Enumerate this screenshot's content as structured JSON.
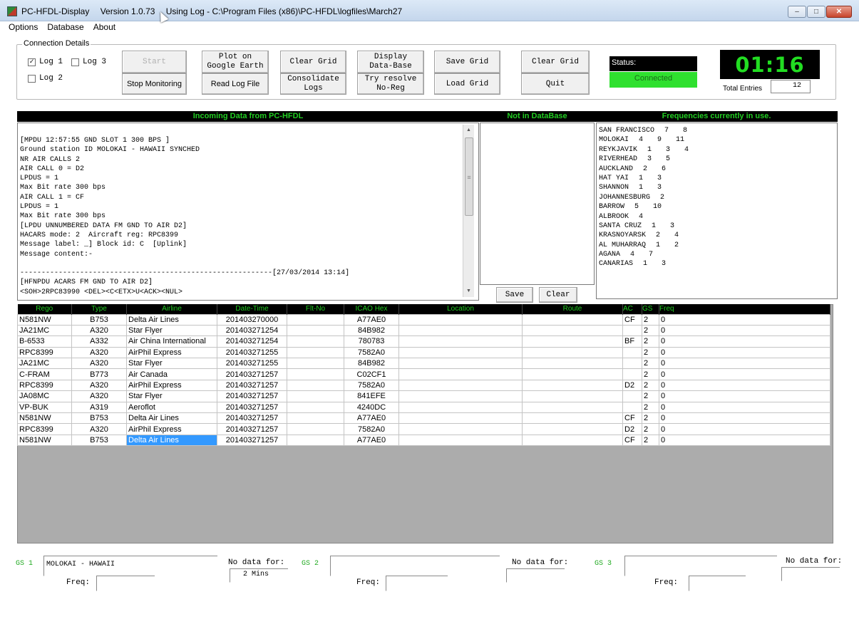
{
  "window": {
    "app_name": "PC-HFDL-Display",
    "version": "Version 1.0.73",
    "log_path": "Using Log - C:\\Program Files (x86)\\PC-HFDL\\logfiles\\March27"
  },
  "menu": [
    "Options",
    "Database",
    "About"
  ],
  "connection": {
    "legend": "Connection Details",
    "log1": "Log 1",
    "log2": "Log 2",
    "log3": "Log 3",
    "log1_checked": true,
    "buttons": {
      "start": "Start",
      "stop_monitoring": "Stop Monitoring",
      "plot_google_earth": "Plot on\nGoogle Earth",
      "read_log_file": "Read Log File",
      "clear_grid_1": "Clear Grid",
      "consolidate_logs": "Consolidate\nLogs",
      "display_database": "Display\nData-Base",
      "try_resolve": "Try resolve\nNo-Reg",
      "save_grid": "Save Grid",
      "load_grid": "Load Grid",
      "clear_grid_2": "Clear Grid",
      "quit": "Quit"
    },
    "status_label": "Status:",
    "status_value": "Connected",
    "clock": "01:16",
    "total_entries_label": "Total Entries",
    "total_entries": "12"
  },
  "panels": {
    "incoming_title": "Incoming Data from PC-HFDL",
    "not_in_db_title": "Not in DataBase",
    "freq_title": "Frequencies currently in use.",
    "incoming_text": "[MPDU 12:57:55 GND SLOT 1 300 BPS ]\nGround station ID MOLOKAI - HAWAII SYNCHED\nNR AIR CALLS 2\nAIR CALL 0 = D2\nLPDUS = 1\nMax Bit rate 300 bps\nAIR CALL 1 = CF\nLPDUS = 1\nMax Bit rate 300 bps\n[LPDU UNNUMBERED DATA FM GND TO AIR D2]\nHACARS mode: 2  Aircraft reg: RPC8399\nMessage label: _] Block id: C  [Uplink]\nMessage content:-\n\n-----------------------------------------------------------[27/03/2014 13:14]\n[HFNPDU ACARS FM GND TO AIR D2]\n<SOH>2RPC83990 <DEL><C<ETX>U<ACK><NUL>",
    "save": "Save",
    "clear": "Clear",
    "frequencies": [
      {
        "name": "SAN FRANCISCO",
        "f": [
          "7",
          "8",
          ""
        ]
      },
      {
        "name": "MOLOKAI",
        "f": [
          "4",
          "9",
          "11"
        ]
      },
      {
        "name": "REYKJAVIK",
        "f": [
          "1",
          "3",
          "4"
        ]
      },
      {
        "name": "RIVERHEAD",
        "f": [
          "3",
          "5",
          ""
        ]
      },
      {
        "name": "AUCKLAND",
        "f": [
          "2",
          "6",
          ""
        ]
      },
      {
        "name": "HAT YAI",
        "f": [
          "1",
          "3",
          ""
        ]
      },
      {
        "name": "SHANNON",
        "f": [
          "1",
          "3",
          ""
        ]
      },
      {
        "name": "JOHANNESBURG",
        "f": [
          "2",
          "",
          ""
        ]
      },
      {
        "name": "BARROW",
        "f": [
          "5",
          "10",
          ""
        ]
      },
      {
        "name": "ALBROOK",
        "f": [
          "4",
          "",
          ""
        ]
      },
      {
        "name": "SANTA CRUZ",
        "f": [
          "1",
          "3",
          ""
        ]
      },
      {
        "name": "KRASNOYARSK",
        "f": [
          "2",
          "4",
          ""
        ]
      },
      {
        "name": "AL MUHARRAQ",
        "f": [
          "1",
          "2",
          ""
        ]
      },
      {
        "name": "AGANA",
        "f": [
          "4",
          "7",
          ""
        ]
      },
      {
        "name": "CANARIAS",
        "f": [
          "1",
          "3",
          ""
        ]
      }
    ]
  },
  "grid": {
    "columns": [
      "Rego",
      "Type",
      "Airline",
      "Date-Time",
      "Flt-No",
      "ICAO Hex",
      "Location",
      "Route",
      "AC",
      "GS",
      "Freq"
    ],
    "rows": [
      [
        "N581NW",
        "B753",
        "Delta Air Lines",
        "201403270000",
        "",
        "A77AE0",
        "",
        "",
        "CF",
        "2",
        "0"
      ],
      [
        "JA21MC",
        "A320",
        "Star Flyer",
        "201403271254",
        "",
        "84B982",
        "",
        "",
        "",
        "2",
        "0"
      ],
      [
        "B-6533",
        "A332",
        "Air China International",
        "201403271254",
        "",
        "780783",
        "",
        "",
        "BF",
        "2",
        "0"
      ],
      [
        "RPC8399",
        "A320",
        "AirPhil Express",
        "201403271255",
        "",
        "7582A0",
        "",
        "",
        "",
        "2",
        "0"
      ],
      [
        "JA21MC",
        "A320",
        "Star Flyer",
        "201403271255",
        "",
        "84B982",
        "",
        "",
        "",
        "2",
        "0"
      ],
      [
        "C-FRAM",
        "B773",
        "Air Canada",
        "201403271257",
        "",
        "C02CF1",
        "",
        "",
        "",
        "2",
        "0"
      ],
      [
        "RPC8399",
        "A320",
        "AirPhil Express",
        "201403271257",
        "",
        "7582A0",
        "",
        "",
        "D2",
        "2",
        "0"
      ],
      [
        "JA08MC",
        "A320",
        "Star Flyer",
        "201403271257",
        "",
        "841EFE",
        "",
        "",
        "",
        "2",
        "0"
      ],
      [
        "VP-BUK",
        "A319",
        "Aeroflot",
        "201403271257",
        "",
        "4240DC",
        "",
        "",
        "",
        "2",
        "0"
      ],
      [
        "N581NW",
        "B753",
        "Delta Air Lines",
        "201403271257",
        "",
        "A77AE0",
        "",
        "",
        "CF",
        "2",
        "0"
      ],
      [
        "RPC8399",
        "A320",
        "AirPhil Express",
        "201403271257",
        "",
        "7582A0",
        "",
        "",
        "D2",
        "2",
        "0"
      ],
      [
        "N581NW",
        "B753",
        "Delta Air Lines",
        "201403271257",
        "",
        "A77AE0",
        "",
        "",
        "CF",
        "2",
        "0"
      ]
    ]
  },
  "bottom": {
    "gs1": "GS 1",
    "gs2": "GS 2",
    "gs3": "GS 3",
    "gs1_name": "MOLOKAI - HAWAII",
    "gs2_name": "",
    "gs3_name": "",
    "no_data_for": "No data for:",
    "no_data_for_colon": "No data for:",
    "gs1_nodata": "2 Mins",
    "freq": "Freq:"
  }
}
